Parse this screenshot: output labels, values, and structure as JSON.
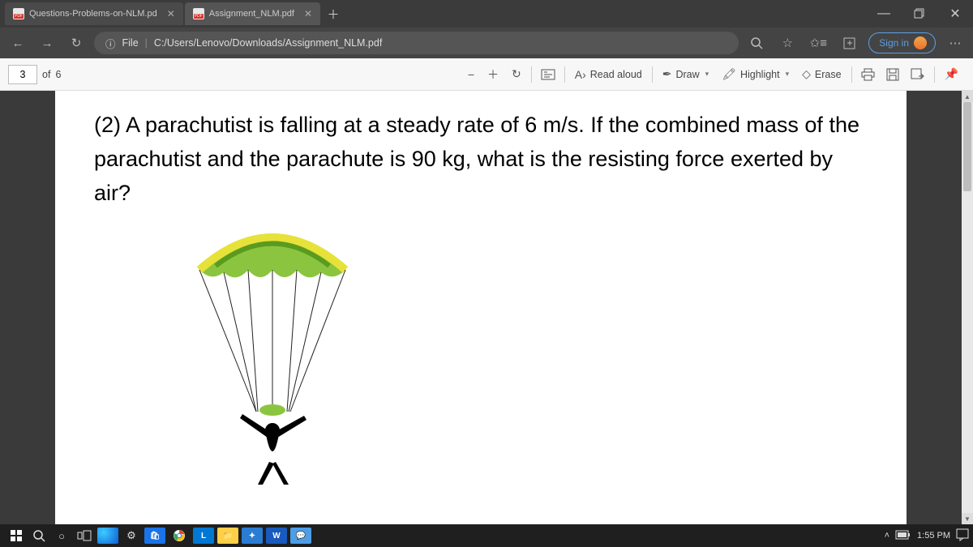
{
  "tabs": [
    {
      "title": "Questions-Problems-on-NLM.pd",
      "active": false
    },
    {
      "title": "Assignment_NLM.pdf",
      "active": true
    }
  ],
  "address": {
    "scheme_label": "File",
    "path": "C:/Users/Lenovo/Downloads/Assignment_NLM.pdf"
  },
  "signin_label": "Sign in",
  "pdf_toolbar": {
    "page_current": "3",
    "page_sep": "of",
    "page_total": "6",
    "read_aloud": "Read aloud",
    "draw": "Draw",
    "highlight": "Highlight",
    "erase": "Erase"
  },
  "document": {
    "question": "(2) A parachutist is falling at a steady rate of 6 m/s. If the combined mass of the parachutist and the parachute is 90 kg, what is the resisting force exerted by air?"
  },
  "system": {
    "clock": "1:55 PM"
  }
}
